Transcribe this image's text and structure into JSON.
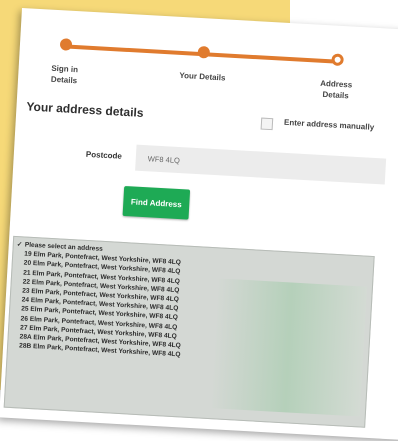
{
  "progress": {
    "steps": [
      {
        "line1": "Sign in",
        "line2": "Details"
      },
      {
        "line1": "Your Details",
        "line2": ""
      },
      {
        "line1": "Address",
        "line2": "Details"
      }
    ],
    "accent_color": "#e07b2e"
  },
  "section": {
    "title": "Your address details",
    "manual_label": "Enter address manually"
  },
  "postcode": {
    "label": "Postcode",
    "value": "WF8 4LQ"
  },
  "find_button": {
    "label": "Find Address",
    "color": "#1eaa55"
  },
  "address_select": {
    "selected_mark": "✓",
    "options": [
      "Please select an address",
      "19 Elm Park, Pontefract, West Yorkshire, WF8 4LQ",
      "20 Elm Park, Pontefract, West Yorkshire, WF8 4LQ",
      "21 Elm Park, Pontefract, West Yorkshire, WF8 4LQ",
      "22 Elm Park, Pontefract, West Yorkshire, WF8 4LQ",
      "23 Elm Park, Pontefract, West Yorkshire, WF8 4LQ",
      "24 Elm Park, Pontefract, West Yorkshire, WF8 4LQ",
      "25 Elm Park, Pontefract, West Yorkshire, WF8 4LQ",
      "26 Elm Park, Pontefract, West Yorkshire, WF8 4LQ",
      "27 Elm Park, Pontefract, West Yorkshire, WF8 4LQ",
      "28A Elm Park, Pontefract, West Yorkshire, WF8 4LQ",
      "28B Elm Park, Pontefract, West Yorkshire, WF8 4LQ"
    ]
  }
}
